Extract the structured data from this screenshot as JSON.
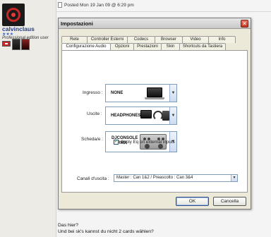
{
  "user": {
    "name": "calvinclaus",
    "stars": "★★★",
    "rank": "Professional edition user"
  },
  "post": {
    "posted": "Posted Mon 19 Jan 09 @ 6:29 pm",
    "lines": [
      "Das hier?",
      "Und bei sk's kannst du nicht 2 cards wählen?"
    ]
  },
  "dialog": {
    "title": "Impostazioni",
    "tabs_row1": [
      "Rete",
      "Controller Esterni",
      "Codecs",
      "Browser",
      "Video",
      "Info"
    ],
    "tabs_row2": [
      "Configurazione Audio",
      "Opzioni",
      "Prestazioni",
      "Skin",
      "Shortcuts da Tastiera"
    ],
    "fields": [
      {
        "label": "Ingresso :",
        "value": "NONE"
      },
      {
        "label": "Uscite :",
        "value": "HEADPHONES"
      },
      {
        "label": "Scheda/e :",
        "value": "DJCONSOLE RMX"
      }
    ],
    "checkbox_label": "Apply Eq on external inputs",
    "canali_label": "Canali d'uscita :",
    "canali_value": "Master : Can 1&2 / Preascolto : Can 3&4",
    "ok_label": "OK",
    "cancel_label": "Cancella"
  }
}
